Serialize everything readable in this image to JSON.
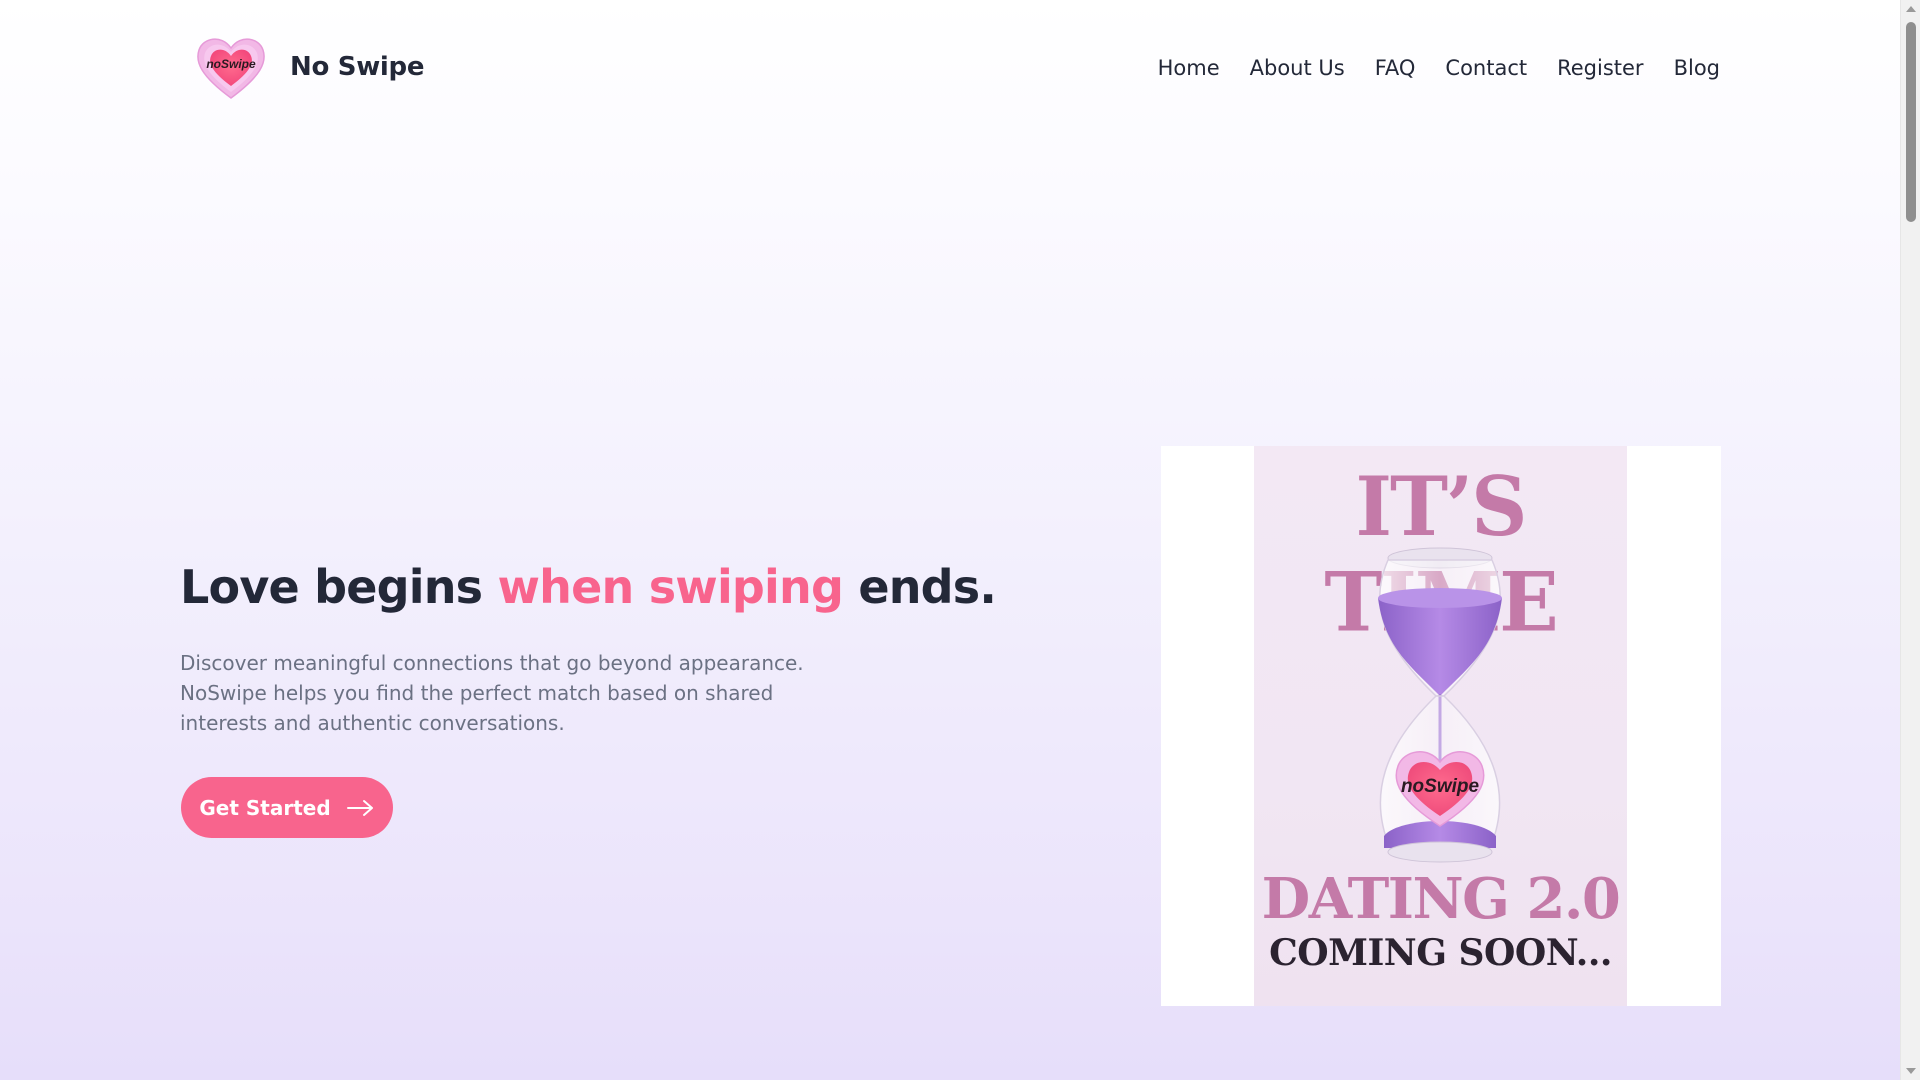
{
  "brand": {
    "name": "No Swipe",
    "logo_text": "noSwipe",
    "logo_icon": "heart-logo-icon"
  },
  "nav": {
    "items": [
      "Home",
      "About Us",
      "FAQ",
      "Contact",
      "Register",
      "Blog"
    ]
  },
  "hero": {
    "title_part1": "Love begins ",
    "title_accent": "when swiping",
    "title_part2": " ends.",
    "description": "Discover meaningful connections that go beyond appearance. NoSwipe helps you find the perfect match based on shared interests and authentic conversations.",
    "cta_label": "Get Started",
    "cta_icon": "arrow-right-icon"
  },
  "poster": {
    "headline": "IT’S TIME",
    "logo_text": "noSwipe",
    "subheadline": "DATING 2.0",
    "tagline": "COMING SOON..."
  },
  "colors": {
    "accent": "#f8648d",
    "text_dark": "#232838",
    "text_muted": "#6b7183",
    "poster_pink": "#c47aa8",
    "sand_purple": "#a27ad6"
  }
}
